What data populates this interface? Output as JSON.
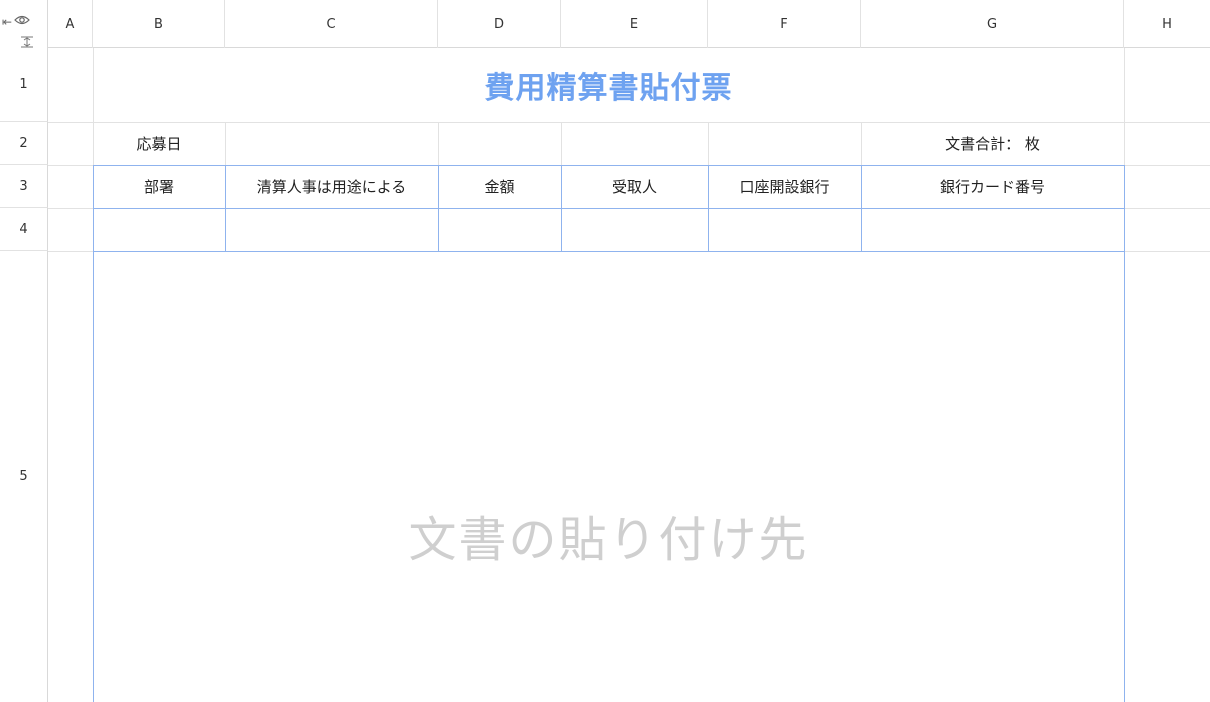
{
  "columns": [
    "A",
    "B",
    "C",
    "D",
    "E",
    "F",
    "G",
    "H"
  ],
  "rows": [
    "1",
    "2",
    "3",
    "4",
    "5"
  ],
  "corner_icons": [
    "eye-icon",
    "collapse-left-icon",
    "collapse-rows-icon"
  ],
  "title": "費用精算書貼付票",
  "row2": {
    "application_date_label": "応募日",
    "document_total_label": "文書合計： 枚"
  },
  "table_headers": [
    "部署",
    "清算人事は用途による",
    "金額",
    "受取人",
    "口座開設銀行",
    "銀行カード番号"
  ],
  "paste_area_placeholder": "文書の貼り付け先",
  "colors": {
    "title": "#6ea2f0",
    "border_accent": "#8fb3ee",
    "placeholder": "#cfcfcf",
    "gridline": "#e2e2e2"
  }
}
